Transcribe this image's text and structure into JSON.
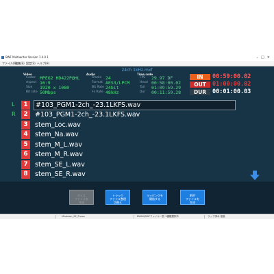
{
  "window": {
    "title": "BWF Multiwriter Version 1.4.0.1",
    "controls": [
      "–",
      "□",
      "×"
    ]
  },
  "menu": [
    "ファイル(F)",
    "編集(E)",
    "設定(S)",
    "ヘルプ(H)"
  ],
  "file": {
    "name": "24ch 1kHz.mxf"
  },
  "video": {
    "header": "Video",
    "codec_label": "Codec",
    "codec": "MPEG2 HD422P@HL",
    "aspect_label": "Aspect",
    "aspect": "16:9",
    "size_label": "Size",
    "size": "1920 x 1080",
    "bitrate_label": "Bit rate",
    "bitrate": "50Mbps"
  },
  "audio": {
    "header": "Audio",
    "tracks_label": "Tracks",
    "tracks": "24",
    "format_label": "Format",
    "format": "AES3/LPCM",
    "bitrate_label": "Bit Rate",
    "bitrate": "24bit",
    "fsrate_label": "Fs Rate",
    "fsrate": "48kHz"
  },
  "timecode": {
    "header": "Time code",
    "fps_label": "FPS",
    "fps": "29.97 DF",
    "head_label": "Head",
    "head": "00:58:00.02",
    "tail_label": "Tail",
    "tail": "01:09:59.29",
    "dur_label": "Dur",
    "dur": "00:11:59.28"
  },
  "inout": {
    "in_label": "IN",
    "in": "00:59:00.02",
    "out_label": "OUT",
    "out": "01:00:00.02",
    "dur_label": "DUR",
    "dur": "00:01:00.03"
  },
  "channels": {
    "left": "L",
    "right": "R"
  },
  "tracks": [
    {
      "num": "1",
      "name": "#103_PGM1-2ch_-23.1LKFS.wav"
    },
    {
      "num": "2",
      "name": "#103_PGM1-2ch_-23.1LKFS.wav"
    },
    {
      "num": "3",
      "name": "stem_Loc.wav"
    },
    {
      "num": "4",
      "name": "stem_Na.wav"
    },
    {
      "num": "5",
      "name": "stem_M_L.wav"
    },
    {
      "num": "6",
      "name": "stem_M_R.wav"
    },
    {
      "num": "7",
      "name": "stem_SE_L.wav"
    },
    {
      "num": "8",
      "name": "stem_SE_R.wav"
    }
  ],
  "buttons": {
    "disabled": "ボイス\nファイルを\n作成",
    "switch": "トラック\nファイル整理\n切替え",
    "wrap": "ラッピングを\n開始する",
    "bwf": "BWF\nファイルを\n生成"
  },
  "status": {
    "left": "",
    "middle": "Mixdown_SE_R.wav",
    "center": "BWAV/BWFファイル一覧   1種類選択中",
    "right": "ラップ済み 推奨"
  },
  "colors": {
    "background": "#173447",
    "accent_green": "#4ee07a",
    "track_badge": "#e23b3b",
    "in": "#e8601c",
    "out": "#d22b2b",
    "action_button": "#1f7fe0"
  }
}
